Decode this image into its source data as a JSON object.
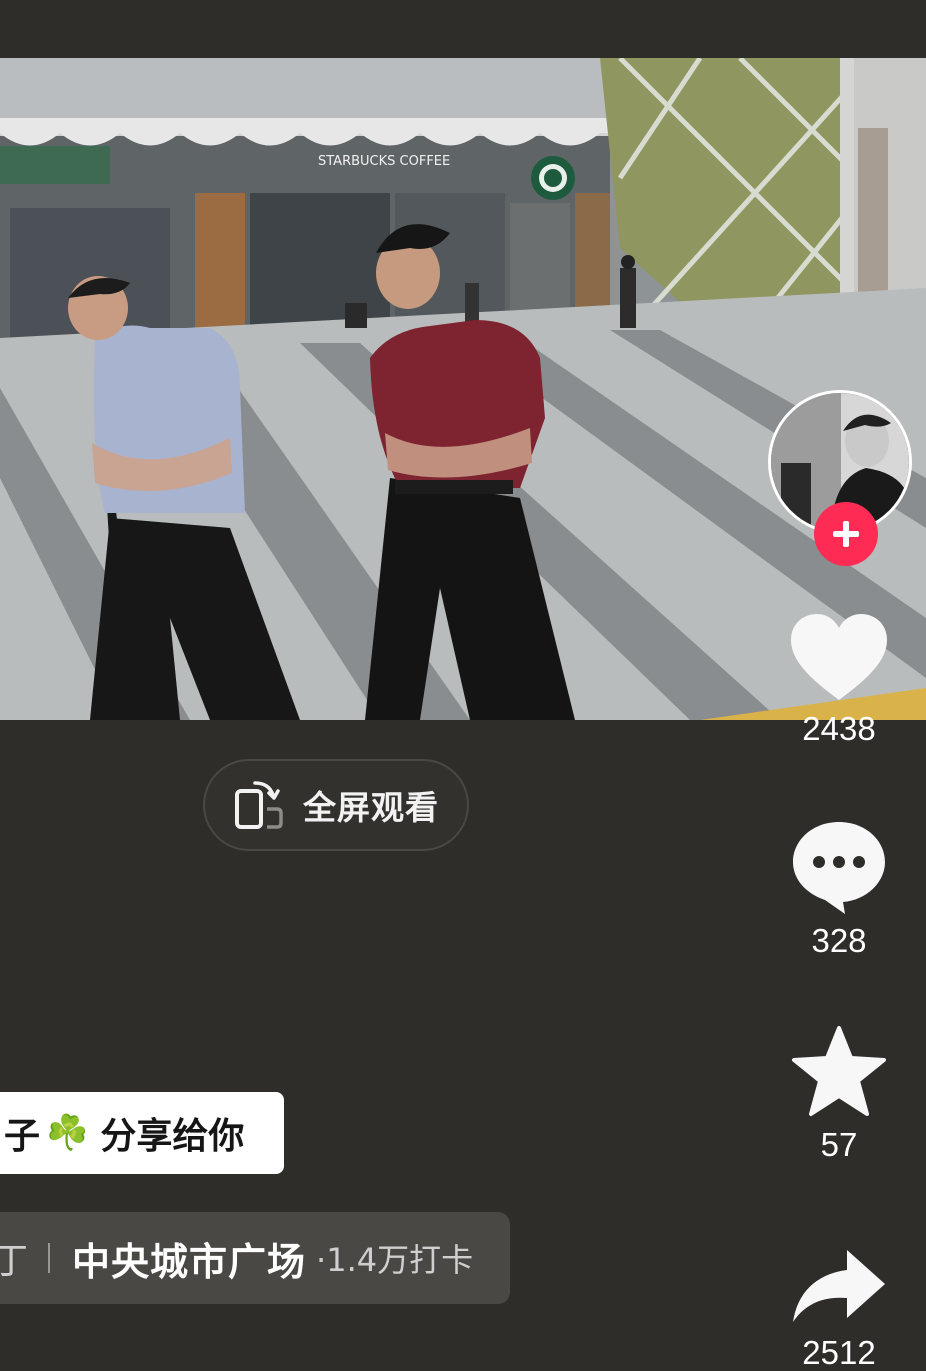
{
  "fullscreen": {
    "label": "全屏观看"
  },
  "video": {
    "storefront_sign": "STARBUCKS COFFEE"
  },
  "actions": {
    "likes": "2438",
    "comments": "328",
    "favorites": "57",
    "shares": "2512"
  },
  "caption": {
    "text_prefix": "子",
    "text_suffix": "分享给你",
    "emoji": "☘️"
  },
  "location": {
    "fragment": "丁",
    "name": "中央城市广场",
    "checkins": "·1.4万打卡"
  },
  "colors": {
    "background": "#2f2d2a",
    "follow_red": "#fe2c55",
    "pill_border": "#4a4845",
    "location_bg": "#4a4845"
  }
}
